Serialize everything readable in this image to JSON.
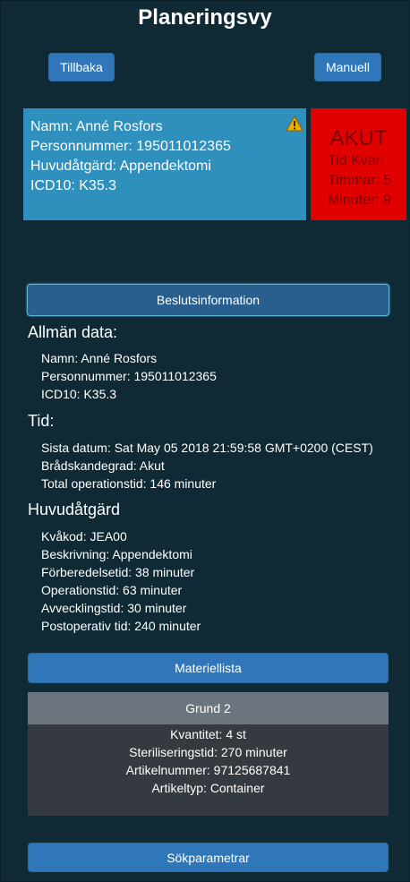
{
  "header": {
    "title": "Planeringsvy",
    "back_label": "Tillbaka",
    "manual_label": "Manuell"
  },
  "patient": {
    "name": "Namn: Anné Rosfors",
    "pnr": "Personnummer: 195011012365",
    "procedure": "Huvudåtgärd: Appendektomi",
    "icd": "ICD10: K35.3"
  },
  "urgency": {
    "title": "AKUT",
    "time_left": "Tid Kvar:",
    "hours": "Timmar: 5",
    "minutes": "Minuter: 9"
  },
  "decision_button": "Beslutsinformation",
  "general": {
    "heading": "Allmän data:",
    "items": [
      "Namn: Anné Rosfors",
      "Personnummer: 195011012365",
      "ICD10: K35.3"
    ]
  },
  "time": {
    "heading": "Tid:",
    "items": [
      "Sista datum: Sat May 05 2018 21:59:58 GMT+0200 (CEST)",
      "Brådskandegrad: Akut",
      "Total operationstid: 146 minuter"
    ]
  },
  "main_procedure": {
    "heading": "Huvudåtgärd",
    "items": [
      "Kvåkod: JEA00",
      "Beskrivning: Appendektomi",
      "Förberedelsetid: 38 minuter",
      "Operationstid: 63 minuter",
      "Avvecklingstid: 30 minuter",
      "Postoperativ tid: 240 minuter"
    ]
  },
  "material_button": "Materiellista",
  "material": {
    "name": "Grund 2",
    "items": [
      "Kvantitet: 4 st",
      "Steriliseringstid: 270 minuter",
      "Artikelnummer: 97125687841",
      "Artikeltyp: Container"
    ]
  },
  "search_button": "Sökparametrar",
  "colors": {
    "background": "#0f2a35",
    "primary": "#2f77b9",
    "patient_card": "#2f8fbd",
    "urgent": "#e10000",
    "warning": "#f0ad00"
  },
  "icons": {
    "warning": "warning-icon"
  }
}
